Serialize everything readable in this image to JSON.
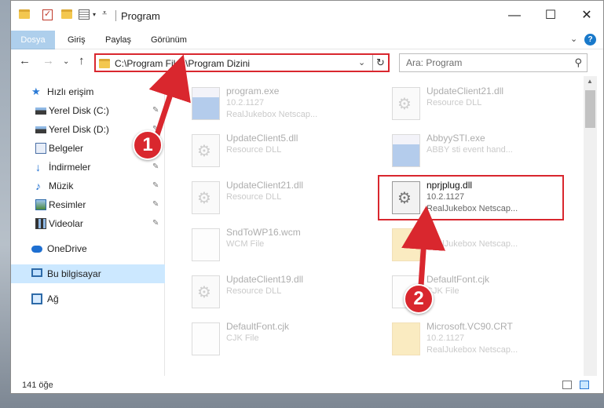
{
  "window": {
    "title": "Program",
    "minimize": "—",
    "maximize": "☐",
    "close": "✕"
  },
  "ribbon": {
    "tabs": [
      "Dosya",
      "Giriş",
      "Paylaş",
      "Görünüm"
    ],
    "collapse": "⌄",
    "help": "?"
  },
  "nav": {
    "back": "←",
    "forward": "→",
    "recent": "⌄",
    "up": "↑",
    "address": "C:\\Program Files\\Program Dizini",
    "address_drop": "⌄",
    "refresh": "↻",
    "search_placeholder": "Ara: Program",
    "search_icon": "⚲"
  },
  "sidebar": {
    "items": [
      {
        "label": "Hızlı erişim",
        "icon": "star-icon",
        "pinned": false
      },
      {
        "label": "Yerel Disk (C:)",
        "icon": "drive-icon",
        "pinned": true
      },
      {
        "label": "Yerel Disk (D:)",
        "icon": "drive-icon",
        "pinned": true
      },
      {
        "label": "Belgeler",
        "icon": "documents-icon",
        "pinned": true
      },
      {
        "label": "İndirmeler",
        "icon": "downloads-icon",
        "pinned": true
      },
      {
        "label": "Müzik",
        "icon": "music-icon",
        "pinned": true
      },
      {
        "label": "Resimler",
        "icon": "pictures-icon",
        "pinned": true
      },
      {
        "label": "Videolar",
        "icon": "videos-icon",
        "pinned": true
      },
      {
        "label": "OneDrive",
        "icon": "onedrive-icon",
        "pinned": false
      },
      {
        "label": "Bu bilgisayar",
        "icon": "computer-icon",
        "pinned": false
      },
      {
        "label": "Ağ",
        "icon": "network-icon",
        "pinned": false
      }
    ],
    "pin_glyph": "📌"
  },
  "files": [
    {
      "name": "program.exe",
      "line2": "10.2.1127",
      "line3": "RealJukebox Netscap...",
      "icon": "exe"
    },
    {
      "name": "UpdateClient21.dll",
      "line2": "Resource DLL",
      "line3": "",
      "icon": "gear"
    },
    {
      "name": "UpdateClient5.dll",
      "line2": "Resource DLL",
      "line3": "",
      "icon": "gear"
    },
    {
      "name": "AbbyySTI.exe",
      "line2": "ABBY sti event hand...",
      "line3": "",
      "icon": "exe"
    },
    {
      "name": "UpdateClient21.dll",
      "line2": "Resource DLL",
      "line3": "",
      "icon": "gear"
    },
    {
      "name": "nprjplug.dll",
      "line2": "10.2.1127",
      "line3": "RealJukebox Netscap...",
      "icon": "gear"
    },
    {
      "name": "SndToWP16.wcm",
      "line2": "WCM File",
      "line3": "",
      "icon": "blank"
    },
    {
      "name": "",
      "line2": "RealJukebox Netscap...",
      "line3": "",
      "icon": "folder"
    },
    {
      "name": "UpdateClient19.dll",
      "line2": "Resource DLL",
      "line3": "",
      "icon": "gear"
    },
    {
      "name": "DefaultFont.cjk",
      "line2": "CJK File",
      "line3": "",
      "icon": "blank"
    },
    {
      "name": "DefaultFont.cjk",
      "line2": "CJK File",
      "line3": "",
      "icon": "blank"
    },
    {
      "name": "Microsoft.VC90.CRT",
      "line2": "10.2.1127",
      "line3": "RealJukebox Netscap...",
      "icon": "folder"
    }
  ],
  "annotations": {
    "badge1": "1",
    "badge2": "2",
    "color": "#d9272e"
  },
  "status": {
    "count": "141 öğe"
  },
  "colors": {
    "accent": "#1979ca",
    "selected_bg": "#cce8ff",
    "highlight": "#d9272e"
  }
}
